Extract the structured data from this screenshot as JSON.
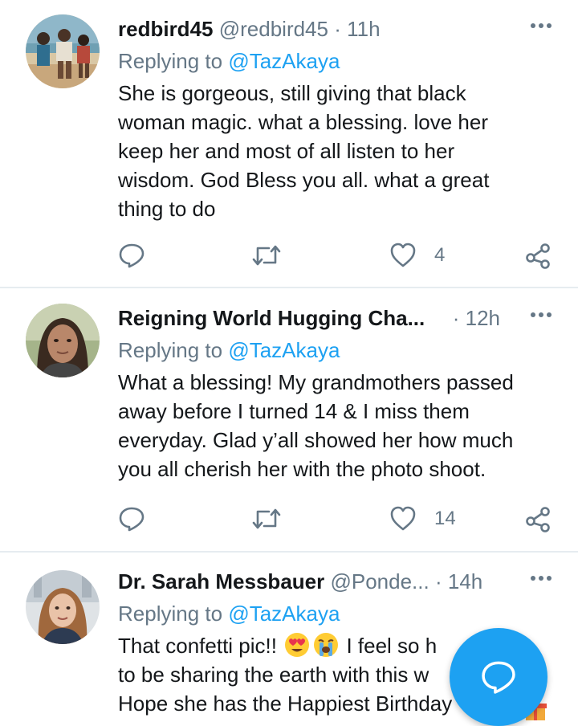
{
  "tweets": [
    {
      "name": "redbird45",
      "handle": "@redbird45",
      "separator": "·",
      "time": "11h",
      "replying_prefix": "Replying to",
      "replying_to": "@TazAkaya",
      "body_lines": [
        "She is gorgeous, still giving that black",
        "woman magic. what a blessing. love her",
        "keep her and most of all listen to her",
        "wisdom. God Bless you all. what a great",
        "thing to do"
      ],
      "likes": "4",
      "avatar_icon": "beach-photo-avatar"
    },
    {
      "name": "Reigning World Hugging Cha...",
      "separator": "·",
      "time": "12h",
      "replying_prefix": "Replying to",
      "replying_to": "@TazAkaya",
      "body_lines": [
        "What a blessing! My grandmothers passed",
        "away before I turned 14 & I miss them",
        "everyday. Glad y’all showed her how much",
        "you all cherish her with the photo shoot."
      ],
      "likes": "14",
      "avatar_icon": "person-avatar"
    },
    {
      "name": "Dr. Sarah Messbauer",
      "handle": "@Ponde...",
      "separator": "·",
      "time": "14h",
      "replying_prefix": "Replying to",
      "replying_to": "@TazAkaya",
      "body_lines": [
        "That confetti pic!!",
        "I feel so h",
        "to be sharing the earth with this w",
        "Hope she has the Happiest Birthday"
      ],
      "avatar_icon": "person-avatar"
    }
  ],
  "icons": {
    "reply": "reply-icon",
    "retweet": "retweet-icon",
    "like": "heart-icon",
    "share": "share-icon",
    "more": "more-icon",
    "compose": "compose-reply-icon",
    "emoji_1": "heart-eyes-emoji",
    "emoji_2": "crying-emoji",
    "emoji_3": "gift-emoji"
  },
  "colors": {
    "accent": "#1da1f2",
    "text": "#14171a",
    "secondary": "#657786",
    "divider": "#e6ecf0"
  }
}
